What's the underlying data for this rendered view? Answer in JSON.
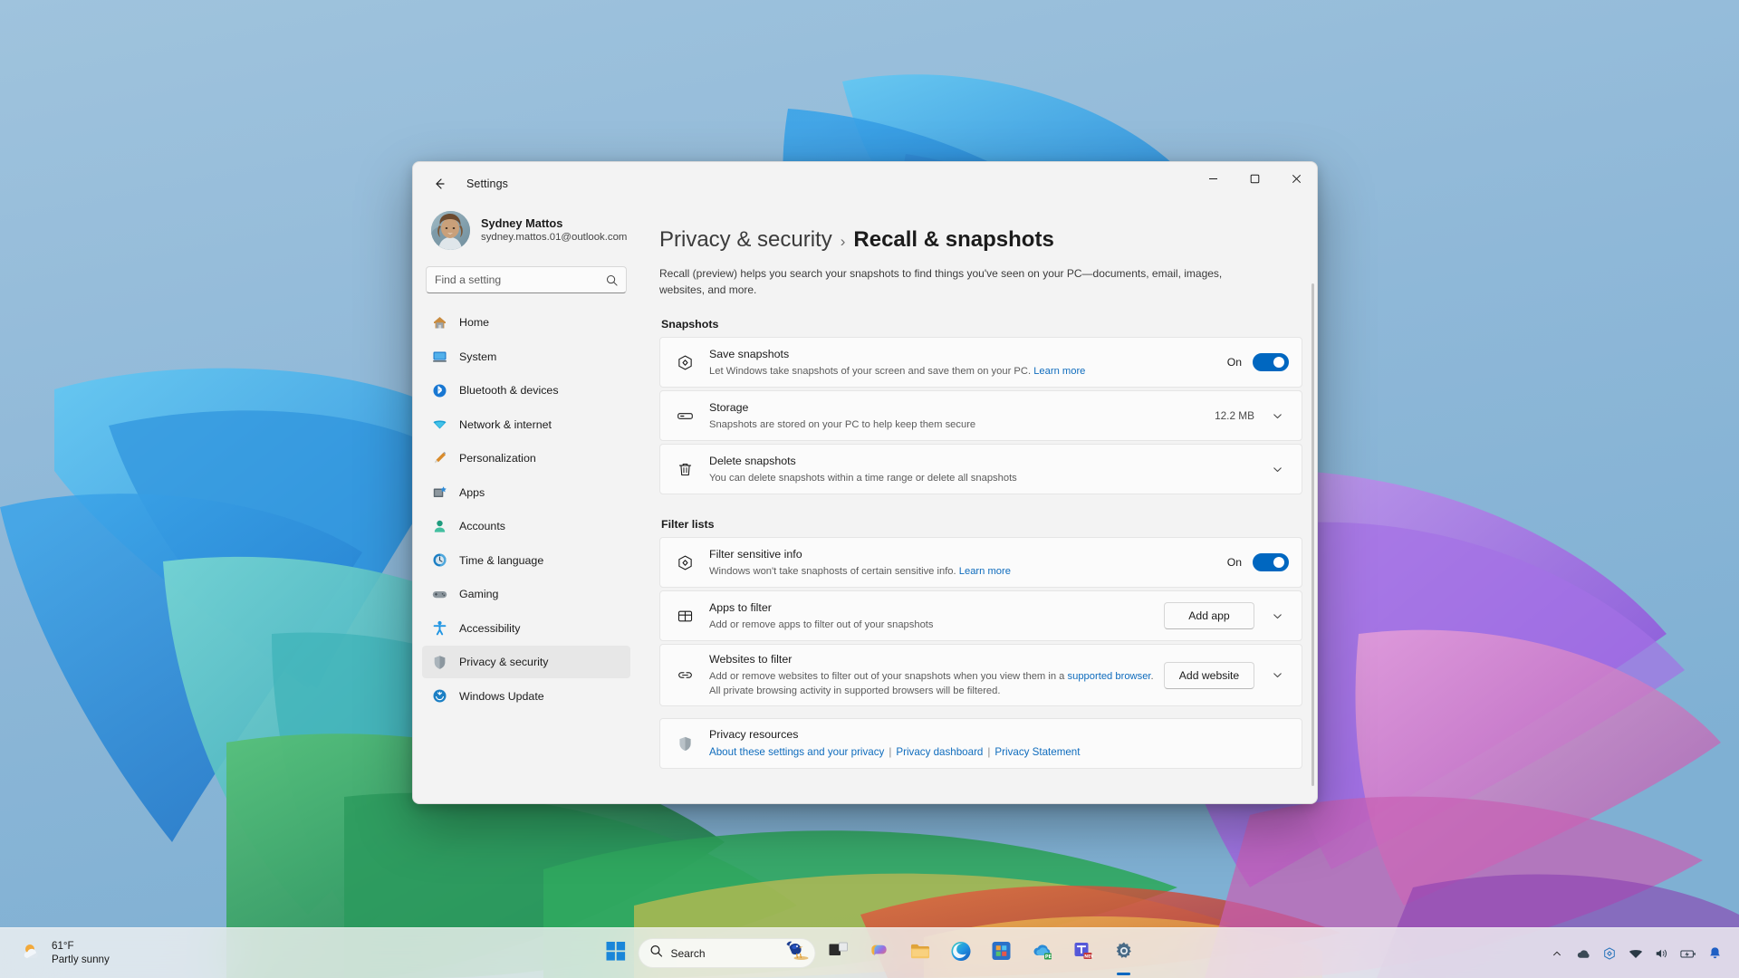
{
  "window": {
    "titlebar_title": "Settings",
    "back_icon": "back-arrow-icon",
    "minimize_icon": "minimize-icon",
    "maximize_icon": "maximize-icon",
    "close_icon": "close-icon"
  },
  "account": {
    "name": "Sydney Mattos",
    "email": "sydney.mattos.01@outlook.com"
  },
  "search": {
    "placeholder": "Find a setting",
    "value": "",
    "icon": "search-icon"
  },
  "sidebar": {
    "items": [
      {
        "label": "Home",
        "icon": "home-icon",
        "selected": false
      },
      {
        "label": "System",
        "icon": "system-icon",
        "selected": false
      },
      {
        "label": "Bluetooth & devices",
        "icon": "bluetooth-icon",
        "selected": false
      },
      {
        "label": "Network & internet",
        "icon": "network-icon",
        "selected": false
      },
      {
        "label": "Personalization",
        "icon": "personalization-icon",
        "selected": false
      },
      {
        "label": "Apps",
        "icon": "apps-icon",
        "selected": false
      },
      {
        "label": "Accounts",
        "icon": "accounts-icon",
        "selected": false
      },
      {
        "label": "Time & language",
        "icon": "time-language-icon",
        "selected": false
      },
      {
        "label": "Gaming",
        "icon": "gaming-icon",
        "selected": false
      },
      {
        "label": "Accessibility",
        "icon": "accessibility-icon",
        "selected": false
      },
      {
        "label": "Privacy & security",
        "icon": "privacy-security-icon",
        "selected": true
      },
      {
        "label": "Windows Update",
        "icon": "windows-update-icon",
        "selected": false
      }
    ]
  },
  "page": {
    "breadcrumb_parent": "Privacy & security",
    "breadcrumb_separator": "›",
    "breadcrumb_current": "Recall & snapshots",
    "description": "Recall (preview) helps you search your snapshots to find things you've seen on your PC—documents, email, images, websites, and more."
  },
  "sections": {
    "snapshots": {
      "title": "Snapshots",
      "save_snapshots": {
        "title": "Save snapshots",
        "subtitle": "Let Windows take snapshots of your screen and save them on your PC.",
        "link": "Learn more",
        "toggle_label": "On",
        "toggle_state": "on",
        "icon": "snapshot-box-icon"
      },
      "storage": {
        "title": "Storage",
        "subtitle": "Snapshots are stored on your PC to help keep them secure",
        "value": "12.2 MB",
        "icon": "drive-icon",
        "chevron": "chevron-down-icon"
      },
      "delete_snapshots": {
        "title": "Delete snapshots",
        "subtitle": "You can delete snapshots within a time range or delete all snapshots",
        "icon": "trash-icon",
        "chevron": "chevron-down-icon"
      }
    },
    "filter_lists": {
      "title": "Filter lists",
      "filter_sensitive": {
        "title": "Filter sensitive info",
        "subtitle": "Windows won't take snaphosts of certain sensitive info.",
        "link": "Learn more",
        "toggle_label": "On",
        "toggle_state": "on",
        "icon": "snapshot-box-icon"
      },
      "apps_to_filter": {
        "title": "Apps to filter",
        "subtitle": "Add or remove apps to filter out of your snapshots",
        "button": "Add app",
        "icon": "apps-grid-icon",
        "chevron": "chevron-down-icon"
      },
      "websites_to_filter": {
        "title": "Websites to filter",
        "subtitle_pre": "Add or remove websites to filter out of your snapshots when you view them in a ",
        "subtitle_link": "supported browser",
        "subtitle_post": ". All private browsing activity in supported browsers will be filtered.",
        "button": "Add website",
        "icon": "link-icon",
        "chevron": "chevron-down-icon"
      }
    },
    "privacy_resources": {
      "title": "Privacy resources",
      "icon": "shield-icon",
      "links": [
        "About these settings and your privacy",
        "Privacy dashboard",
        "Privacy Statement"
      ],
      "separator": "|"
    }
  },
  "taskbar": {
    "weather": {
      "temperature": "61°F",
      "condition": "Partly sunny",
      "icon": "partly-sunny-icon"
    },
    "start_icon": "windows-start-icon",
    "search": {
      "label": "Search",
      "icon": "search-icon",
      "decoration": "bird-icon"
    },
    "items": [
      {
        "name": "task-view-icon"
      },
      {
        "name": "copilot-icon"
      },
      {
        "name": "file-explorer-icon"
      },
      {
        "name": "edge-icon"
      },
      {
        "name": "microsoft-store-icon"
      },
      {
        "name": "onedrive-icon"
      },
      {
        "name": "teams-icon"
      },
      {
        "name": "settings-icon"
      }
    ],
    "tray": [
      {
        "name": "show-hidden-icons-chevron"
      },
      {
        "name": "cloud-icon"
      },
      {
        "name": "recall-icon"
      },
      {
        "name": "wifi-icon"
      },
      {
        "name": "volume-icon"
      },
      {
        "name": "battery-icon"
      },
      {
        "name": "notification-bell-icon"
      }
    ]
  },
  "colors": {
    "accent": "#0067c0",
    "link": "#0f6cbd",
    "window_bg": "#f3f3f3",
    "card_bg": "#fbfbfb"
  }
}
